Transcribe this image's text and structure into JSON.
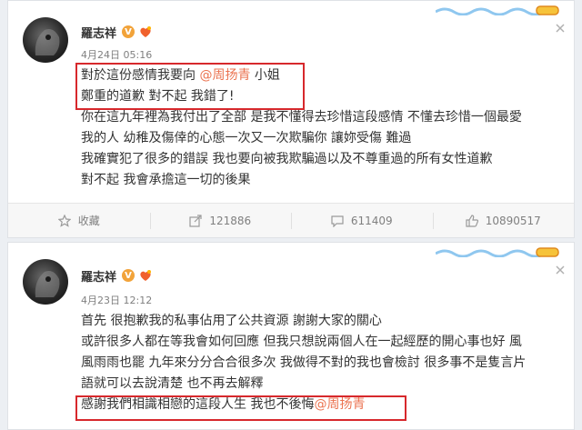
{
  "colors": {
    "mention": "#eb7350",
    "highlight_box": "#d7282c",
    "vip": "#f2a33a"
  },
  "posts": [
    {
      "username": "羅志祥",
      "verified": "V",
      "timestamp": "4月24日 05:16",
      "lines": [
        {
          "text": "對於這份感情我要向 ",
          "mention": "@周扬青",
          "after": " 小姐"
        },
        {
          "text": "鄭重的道歉 對不起 我錯了!"
        },
        {
          "text": "你在這九年裡為我付出了全部 是我不懂得去珍惜這段感情 不懂去珍惜一個最愛"
        },
        {
          "text": "我的人 幼稚及傷倖的心態一次又一次欺騙你 讓妳受傷 難過"
        },
        {
          "text": "我確實犯了很多的錯誤 我也要向被我欺騙過以及不尊重過的所有女性道歉"
        },
        {
          "text": "對不起   我會承擔這一切的後果"
        }
      ],
      "actions": [
        {
          "icon": "star-icon",
          "label": "收藏"
        },
        {
          "icon": "share-icon",
          "label": "121886"
        },
        {
          "icon": "comment-icon",
          "label": "611409"
        },
        {
          "icon": "like-icon",
          "label": "10890517"
        }
      ]
    },
    {
      "username": "羅志祥",
      "verified": "V",
      "timestamp": "4月23日 12:12",
      "lines": [
        {
          "text": "首先 很抱歉我的私事佔用了公共資源 謝謝大家的關心"
        },
        {
          "text": "或許很多人都在等我會如何回應 但我只想說兩個人在一起經歷的開心事也好 風"
        },
        {
          "text": "風雨雨也罷 九年來分分合合很多次 我做得不對的我也會檢討 很多事不是隻言片"
        },
        {
          "text": "語就可以去說清楚 也不再去解釋"
        },
        {
          "text": "感謝我們相識相戀的這段人生 我也不後悔",
          "mention": "@周扬青",
          "after": ""
        }
      ]
    }
  ]
}
